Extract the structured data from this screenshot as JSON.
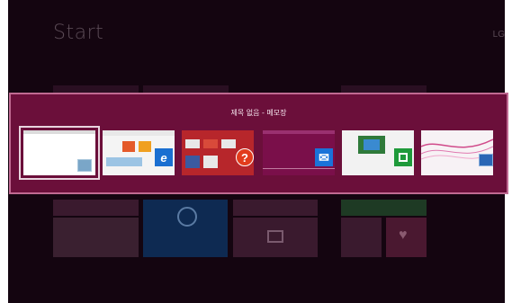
{
  "start_screen": {
    "title": "Start",
    "user_name": "LG"
  },
  "switcher": {
    "title": "제목 없음 - 메모장",
    "apps": [
      {
        "name": "notepad",
        "selected": true
      },
      {
        "name": "internet-explorer",
        "badge_icon": "ie-icon",
        "badge_color": "#1a6fd1"
      },
      {
        "name": "help-and-tips",
        "badge_icon": "help-icon",
        "badge_color": "#e23c1c",
        "badge_glyph": "?"
      },
      {
        "name": "mail",
        "badge_icon": "mail-icon",
        "badge_color": "#1a73d9",
        "badge_glyph": "✉"
      },
      {
        "name": "store",
        "badge_icon": "store-icon",
        "badge_color": "#1e9a3a"
      },
      {
        "name": "desktop",
        "badge_icon": "desktop-icon",
        "badge_color": "#2a66b5"
      }
    ]
  },
  "colors": {
    "accent": "#6b0f3a",
    "border": "#c06a92",
    "background": "#140510"
  }
}
